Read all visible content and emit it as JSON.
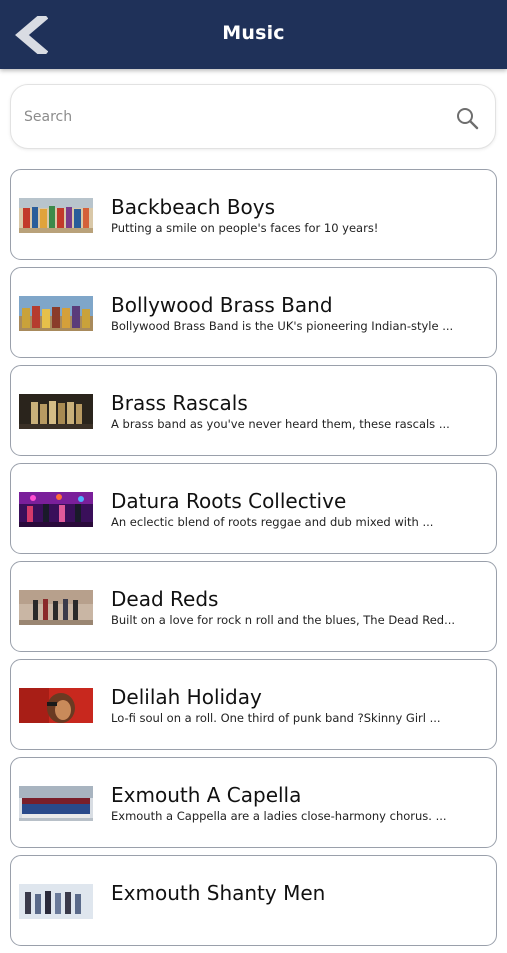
{
  "header": {
    "title": "Music",
    "back_icon": "chevron-left-icon",
    "background": "#1f3159"
  },
  "search": {
    "placeholder": "Search",
    "value": "",
    "icon": "search-icon"
  },
  "items": [
    {
      "name": "Backbeach Boys",
      "desc": "Putting a smile on people's faces for 10 years!"
    },
    {
      "name": "Bollywood Brass Band",
      "desc": "Bollywood Brass Band is the UK's pioneering Indian-style ..."
    },
    {
      "name": "Brass Rascals",
      "desc": "A brass band as you've never heard them, these rascals ..."
    },
    {
      "name": "Datura Roots Collective",
      "desc": "An eclectic blend of roots reggae and dub mixed with ..."
    },
    {
      "name": "Dead Reds",
      "desc": "Built on a love for rock n roll and the blues, The Dead Red..."
    },
    {
      "name": "Delilah Holiday",
      "desc": "Lo-fi soul on a roll. One third of punk band ?Skinny Girl ..."
    },
    {
      "name": "Exmouth A Capella",
      "desc": "Exmouth a Cappella are a ladies close-harmony chorus. ..."
    },
    {
      "name": "Exmouth Shanty Men",
      "desc": ""
    }
  ]
}
